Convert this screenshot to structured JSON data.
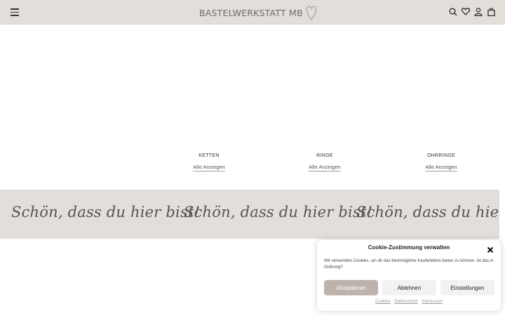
{
  "header": {
    "logo_text": "BASTELWERKSTATT MB",
    "icons": [
      "menu-icon",
      "search-icon",
      "heart-icon",
      "user-icon",
      "bag-icon"
    ]
  },
  "categories": [
    {
      "title": "KETTEN",
      "link": "Alle Anzeigen"
    },
    {
      "title": "RINGE",
      "link": "Alle Anzeigen"
    },
    {
      "title": "OHRRINGE",
      "link": "Alle Anzeigen"
    }
  ],
  "banner": {
    "items": [
      "Schön, dass du hier bist!",
      "Schön, dass du hier bist!",
      "Schön, dass du hier bist!"
    ]
  },
  "cookie": {
    "title": "Cookie-Zustimmung verwalten",
    "text": "Wir verwenden Cookies, um dir das bestmögliche Kauferlebnis bieten zu können. Ist das in Ordnung?",
    "accept": "Akzeptieren",
    "deny": "Ablehnen",
    "settings": "Einstellungen",
    "links": [
      "Cookies",
      "Datenschutz",
      "Impressum"
    ]
  },
  "colors": {
    "header_bg": "#e2deda",
    "accent_button": "#beb3ac"
  }
}
